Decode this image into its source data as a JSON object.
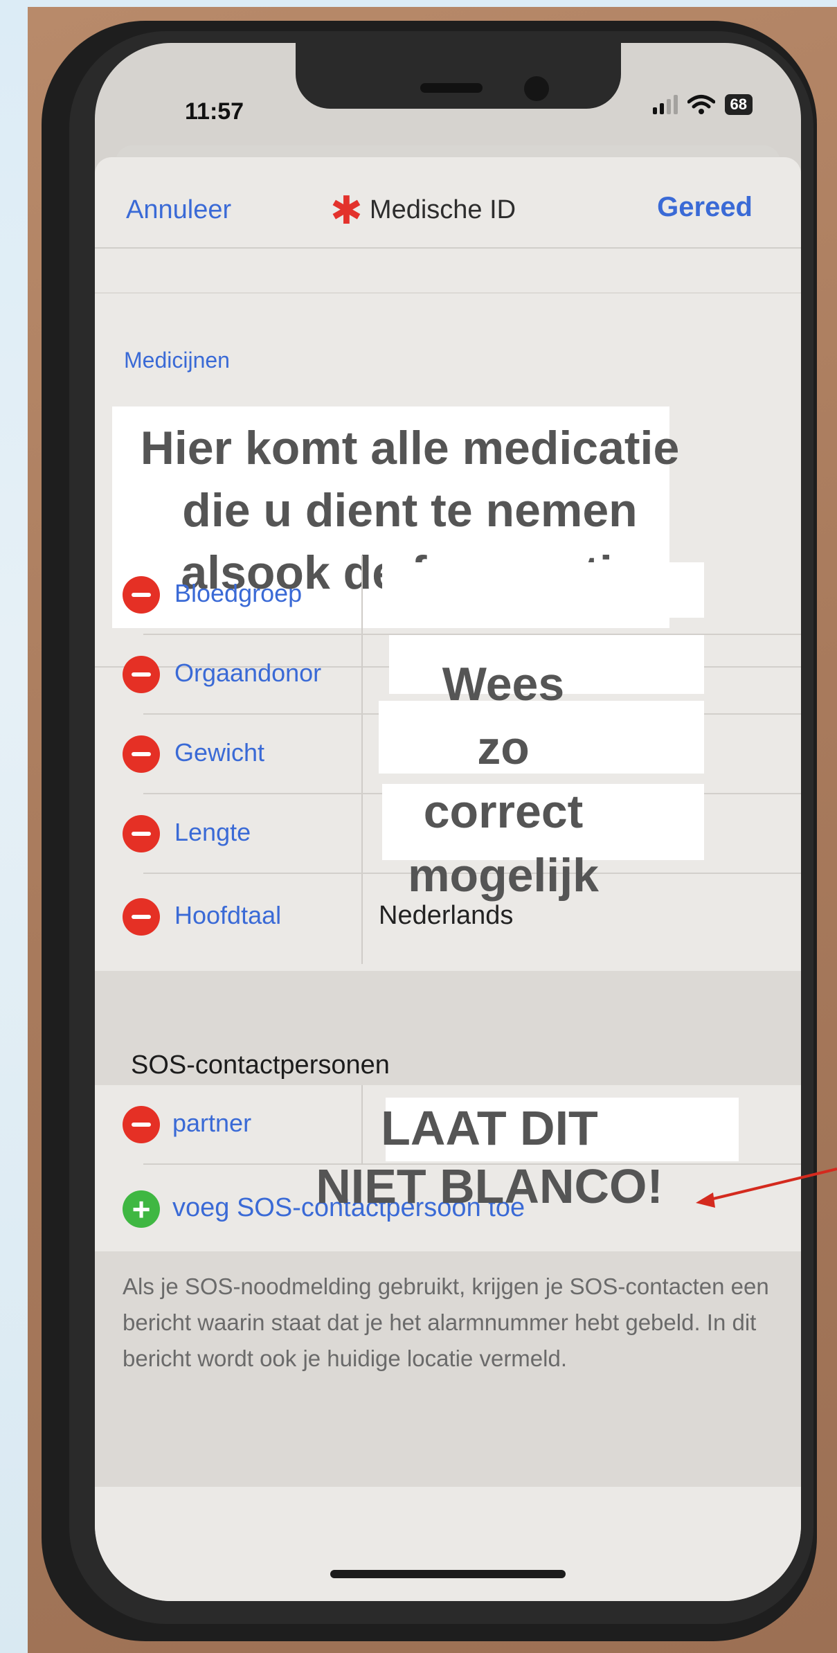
{
  "status": {
    "time": "11:57",
    "battery": "68"
  },
  "nav": {
    "cancel": "Annuleer",
    "title": "Medische ID",
    "done": "Gereed"
  },
  "medications": {
    "label": "Medicijnen",
    "overlay_lines": [
      "Hier komt alle medicatie",
      "die u dient te nemen",
      "alsook de frequentie"
    ]
  },
  "fields": [
    {
      "label": "Bloedgroep",
      "value": ""
    },
    {
      "label": "Orgaandonor",
      "value": ""
    },
    {
      "label": "Gewicht",
      "value": ""
    },
    {
      "label": "Lengte",
      "value": ""
    },
    {
      "label": "Hoofdtaal",
      "value": "Nederlands"
    }
  ],
  "fields_overlay": [
    "Wees",
    "zo",
    "correct",
    "mogelijk"
  ],
  "sos": {
    "header": "SOS-contactpersonen",
    "contact_label": "partner",
    "add_label": "voeg SOS-contactpersoon toe",
    "overlay_lines": [
      "LAAT DIT",
      "NIET BLANCO!"
    ],
    "footnote": "Als je SOS-noodmelding gebruikt, krijgen je SOS-contacten een bericht waarin staat dat je het alarmnummer hebt gebeld. In dit bericht wordt ook je huidige locatie vermeld."
  },
  "colors": {
    "link": "#3a6ad6",
    "remove": "#e53025",
    "add": "#3fb742",
    "annotation": "#555555",
    "arrow": "#d42a1e"
  }
}
